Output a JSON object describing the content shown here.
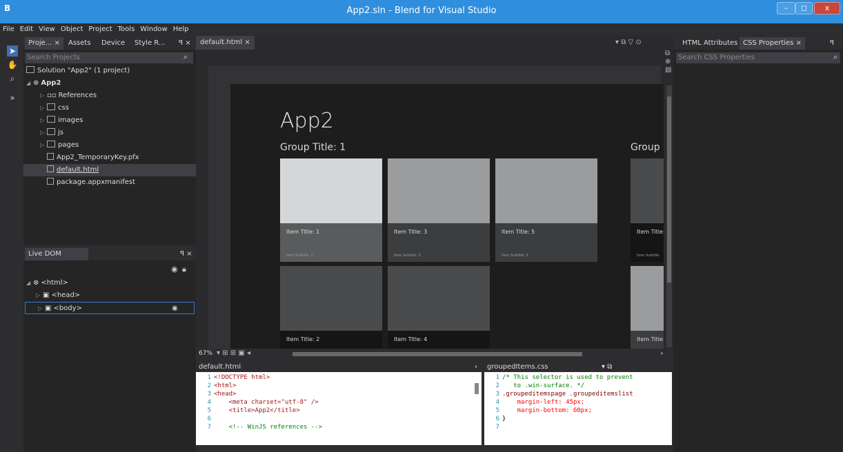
{
  "window": {
    "title": "App2.sln - Blend for Visual Studio",
    "min": "–",
    "max": "◻",
    "close": "x"
  },
  "menu": [
    "File",
    "Edit",
    "View",
    "Object",
    "Project",
    "Tools",
    "Window",
    "Help"
  ],
  "projects_panel": {
    "tabs": [
      "Proje... ×",
      "Assets",
      "Device",
      "Style R..."
    ],
    "search_placeholder": "Search Projects",
    "solution": "Solution \"App2\" (1 project)",
    "project": "App2",
    "items": [
      "References",
      "css",
      "images",
      "js",
      "pages",
      "App2_TemporaryKey.pfx",
      "default.html",
      "package.appxmanifest"
    ]
  },
  "live_dom": {
    "title": "Live DOM",
    "nodes": [
      "<html>",
      "<head>",
      "<body>"
    ]
  },
  "designer": {
    "doc_tab": "default.html ×",
    "app_title": "App2",
    "group1_title": "Group Title: 1",
    "group2_title": "Group",
    "tiles": [
      {
        "title": "Item Title: 1",
        "subtitle": "Item Subtitle: 1"
      },
      {
        "title": "Item Title: 3",
        "subtitle": "Item Subtitle: 3"
      },
      {
        "title": "Item Title: 5",
        "subtitle": "Item Subtitle: 5"
      },
      {
        "title": "Item Title:",
        "subtitle": "Item Subtitle"
      },
      {
        "title": "Item Title: 2",
        "subtitle": ""
      },
      {
        "title": "Item Title: 4",
        "subtitle": ""
      },
      {
        "title": "Item Title:",
        "subtitle": ""
      }
    ],
    "zoom": "67%"
  },
  "code_editor_html": {
    "file": "default.html",
    "lines": [
      {
        "n": "1",
        "code": "<!DOCTYPE html>"
      },
      {
        "n": "2",
        "code": "<html>"
      },
      {
        "n": "3",
        "code": "<head>"
      },
      {
        "n": "4",
        "code": "    <meta charset=\"utf-8\" />"
      },
      {
        "n": "5",
        "code": "    <title>App2</title>"
      },
      {
        "n": "6",
        "code": ""
      },
      {
        "n": "7",
        "code": "    <!-- WinJS references -->"
      }
    ]
  },
  "code_editor_css": {
    "file": "groupedItems.css",
    "lines": [
      {
        "n": "1",
        "code": "/* This selector is used to prevent"
      },
      {
        "n": "2",
        "code": "   to .win-surface. */"
      },
      {
        "n": "3",
        "code": ".groupeditemspage .groupeditemslist"
      },
      {
        "n": "4",
        "code": "    margin-left: 45px;"
      },
      {
        "n": "5",
        "code": "    margin-bottom: 60px;"
      },
      {
        "n": "6",
        "code": "}"
      },
      {
        "n": "7",
        "code": ""
      }
    ]
  },
  "right_panel": {
    "tabs": [
      "HTML Attributes",
      "CSS Properties ×"
    ],
    "search_placeholder": "Search CSS Properties"
  },
  "colors": {
    "accent": "#2f8ede",
    "tile_light": "#d4d6d8",
    "tile_mid": "#9b9c9e",
    "tile_dark": "#4a4b4d"
  }
}
